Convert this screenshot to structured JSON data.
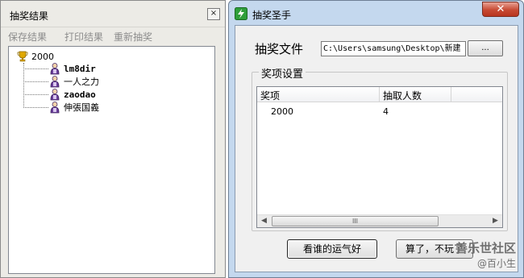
{
  "results_window": {
    "title": "抽奖结果",
    "close_glyph": "×",
    "menu": [
      "保存结果",
      "打印结果",
      "重新抽奖"
    ],
    "tree": {
      "root_label": "2000",
      "root_icon": "trophy-icon",
      "item_icon": "person-icon",
      "winners": [
        "lm8dir",
        "一人之力",
        "zaodao",
        "伸張国義"
      ]
    }
  },
  "main_window": {
    "title": "抽奖圣手",
    "app_icon": "lottery-app-icon",
    "close_glyph": "✕",
    "file_label": "抽奖文件",
    "file_path": "C:\\Users\\samsung\\Desktop\\新建",
    "browse_label": "...",
    "prize_group_label": "奖项设置",
    "table": {
      "columns": [
        "奖项",
        "抽取人数"
      ],
      "rows": [
        {
          "prize": "2000",
          "count": "4"
        }
      ]
    },
    "scrollbar_grip": "III",
    "draw_button": "看谁的运气好",
    "quit_button": "算了，不玩了"
  },
  "watermark": {
    "main": "善乐世社区",
    "sub": "@百小生"
  },
  "colors": {
    "window_frame_blue": "#c4d8ee",
    "close_button_red": "#c74a33",
    "trophy_gold": "#e0a800",
    "app_icon_green": "#2e9e3a"
  }
}
